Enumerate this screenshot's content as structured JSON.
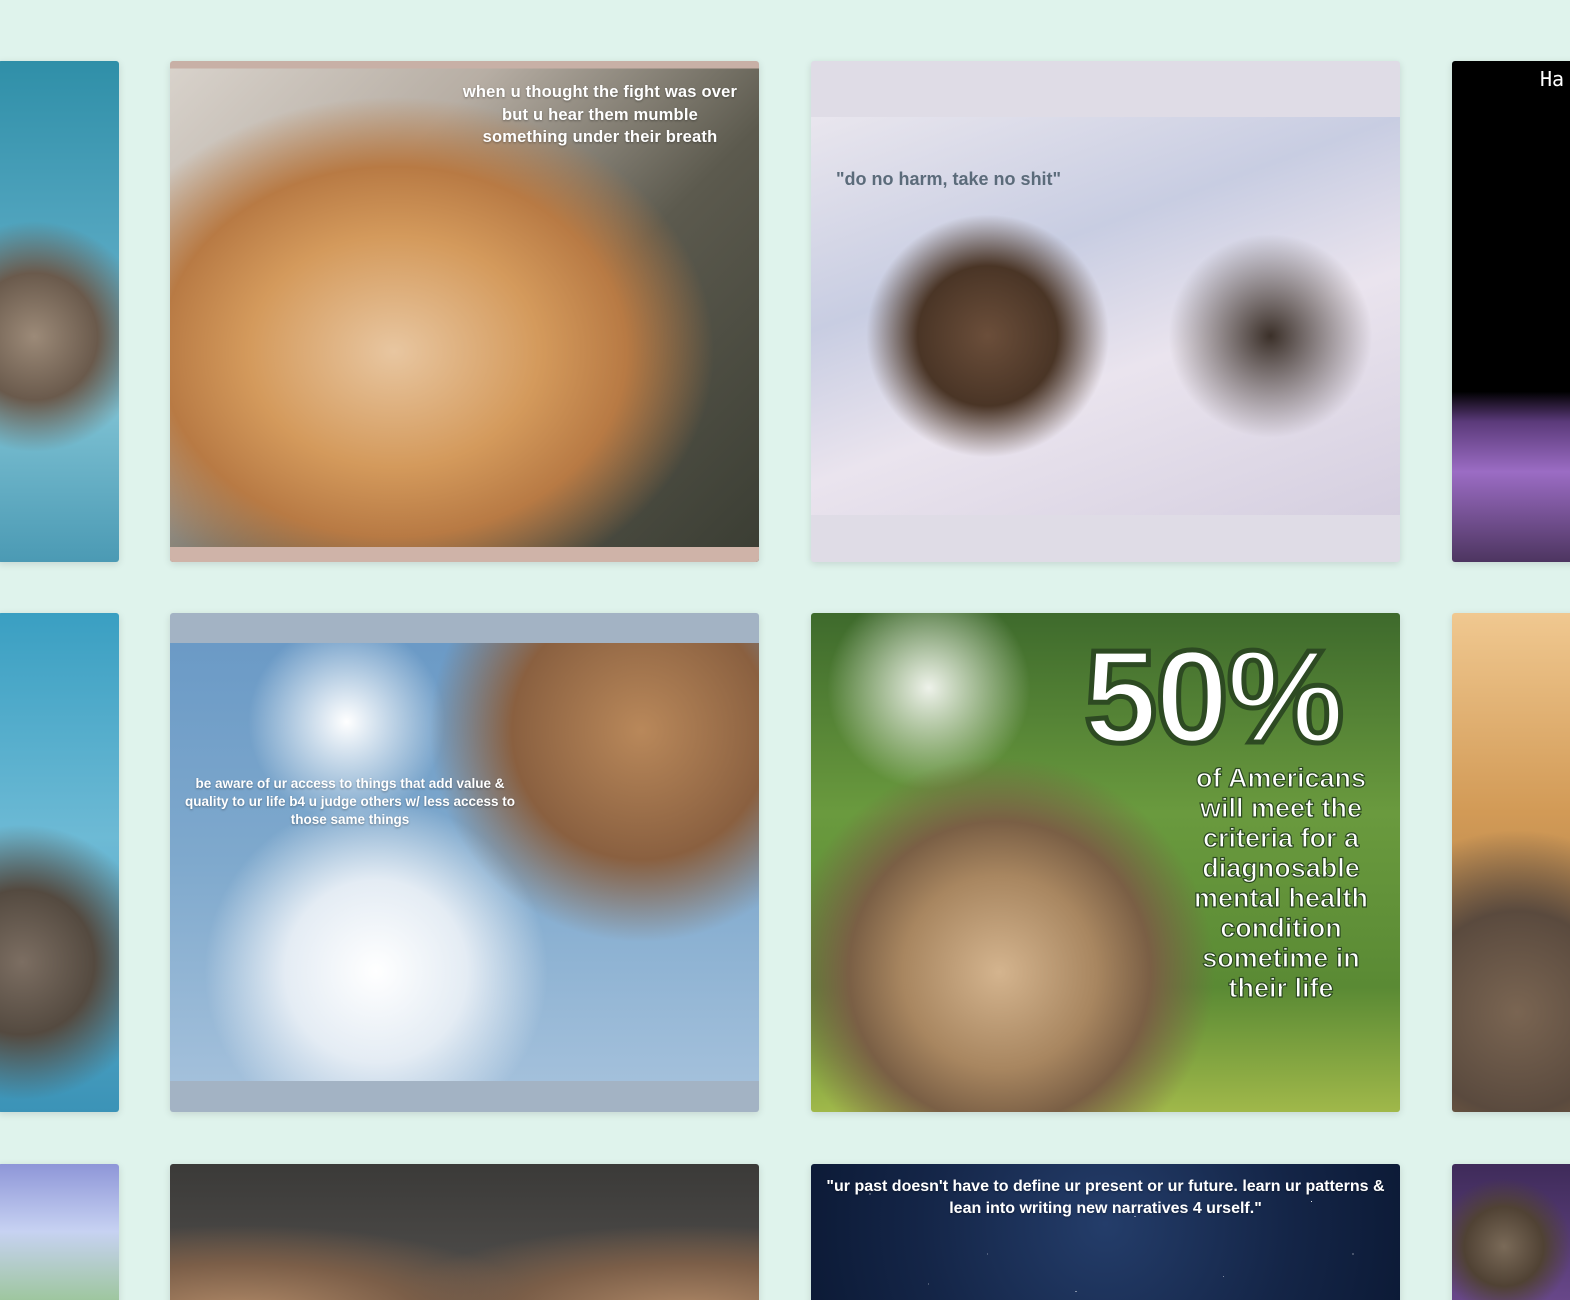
{
  "gallery": {
    "tiles": [
      {
        "id": "r1c0",
        "caption": ""
      },
      {
        "id": "r1c1",
        "caption": "when u thought the fight was over but u hear them mumble something under their breath"
      },
      {
        "id": "r1c2",
        "caption": "\"do no harm, take no shit\""
      },
      {
        "id": "r1c3",
        "caption": "Ha"
      },
      {
        "id": "r2c0",
        "caption": ""
      },
      {
        "id": "r2c1",
        "caption": "be aware of ur access to things that add value & quality to ur life b4 u judge others w/ less access  to those same things"
      },
      {
        "id": "r2c2",
        "headline": "50%",
        "caption": "of Americans will meet the criteria for a diagnosable mental health condition sometime in their life"
      },
      {
        "id": "r2c3",
        "caption": ""
      },
      {
        "id": "r3c0",
        "caption": ""
      },
      {
        "id": "r3c1",
        "caption": ""
      },
      {
        "id": "r3c2",
        "caption": "\"ur past doesn't have to define ur present or ur future. learn ur patterns & lean into writing new narratives 4 urself.\""
      },
      {
        "id": "r3c3",
        "caption": ""
      }
    ]
  },
  "colors": {
    "background": "#dff3ec",
    "caption_text": "#ffffff",
    "dark_caption": "#5b6b7a"
  }
}
